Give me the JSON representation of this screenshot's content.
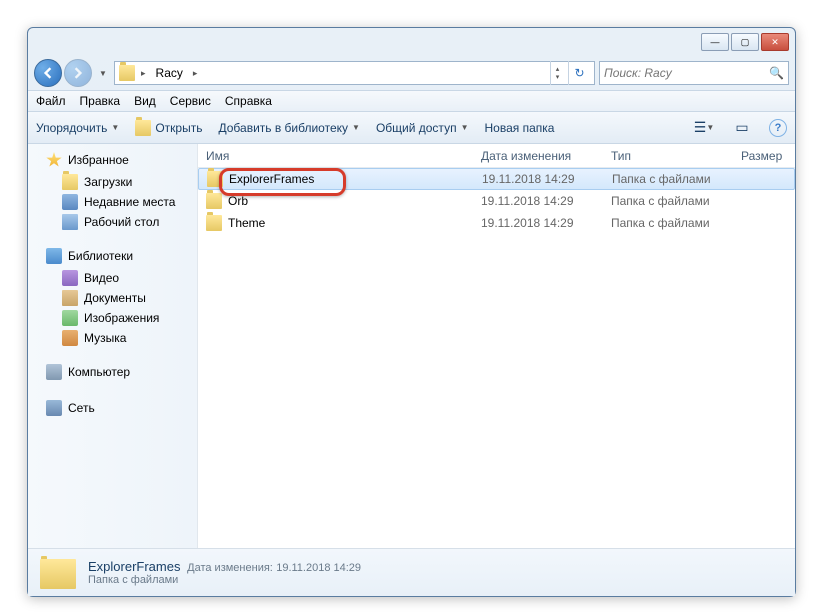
{
  "titlebar": {
    "min": "—",
    "max": "▢",
    "close": "✕"
  },
  "nav": {
    "crumb": "Racy",
    "search_placeholder": "Поиск: Racy"
  },
  "menubar": [
    "Файл",
    "Правка",
    "Вид",
    "Сервис",
    "Справка"
  ],
  "toolbar": {
    "organize": "Упорядочить",
    "open": "Открыть",
    "addlib": "Добавить в библиотеку",
    "share": "Общий доступ",
    "newfolder": "Новая папка"
  },
  "columns": {
    "name": "Имя",
    "date": "Дата изменения",
    "type": "Тип",
    "size": "Размер"
  },
  "sidebar": {
    "favorites": {
      "label": "Избранное",
      "items": [
        "Загрузки",
        "Недавние места",
        "Рабочий стол"
      ]
    },
    "libraries": {
      "label": "Библиотеки",
      "items": [
        "Видео",
        "Документы",
        "Изображения",
        "Музыка"
      ]
    },
    "computer": {
      "label": "Компьютер"
    },
    "network": {
      "label": "Сеть"
    }
  },
  "rows": [
    {
      "name": "ExplorerFrames",
      "date": "19.11.2018 14:29",
      "type": "Папка с файлами",
      "selected": true
    },
    {
      "name": "Orb",
      "date": "19.11.2018 14:29",
      "type": "Папка с файлами",
      "selected": false
    },
    {
      "name": "Theme",
      "date": "19.11.2018 14:29",
      "type": "Папка с файлами",
      "selected": false
    }
  ],
  "status": {
    "name": "ExplorerFrames",
    "meta_label": "Дата изменения:",
    "meta_value": "19.11.2018 14:29",
    "type": "Папка с файлами"
  }
}
